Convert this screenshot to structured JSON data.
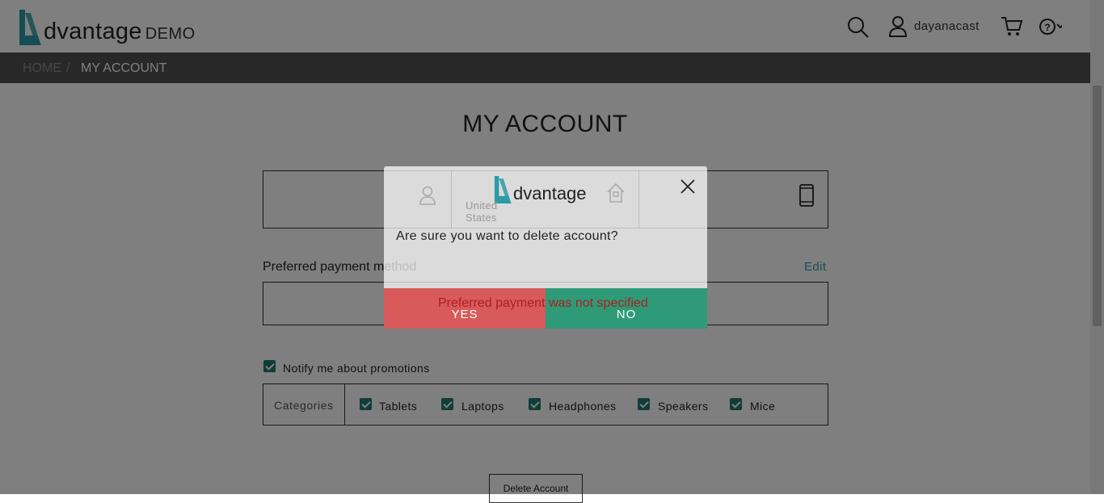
{
  "header": {
    "logo_word": "dvantage",
    "logo_suffix": "DEMO",
    "username": "dayanacast",
    "icons": [
      "search-icon",
      "user-icon",
      "cart-icon",
      "help-icon",
      "chevron-down-icon"
    ]
  },
  "breadcrumb": {
    "home": "HOME",
    "separator": "/",
    "current": "MY ACCOUNT"
  },
  "page": {
    "title": "MY ACCOUNT",
    "account_details": {
      "country": "United States"
    },
    "payment": {
      "label": "Preferred payment method",
      "edit_label": "Edit",
      "status": "Preferred payment was not specified"
    },
    "promotions": {
      "notify_label": "Notify me about promotions",
      "notify_checked": true,
      "categories_title": "Categories",
      "categories": [
        {
          "label": "Tablets",
          "checked": true
        },
        {
          "label": "Laptops",
          "checked": true
        },
        {
          "label": "Headphones",
          "checked": true
        },
        {
          "label": "Speakers",
          "checked": true
        },
        {
          "label": "Mice",
          "checked": true
        }
      ]
    },
    "delete_button": "Delete Account"
  },
  "modal": {
    "logo_word": "dvantage",
    "question": "Are sure you want to delete account?",
    "yes_label": "YES",
    "no_label": "NO"
  },
  "colors": {
    "brand_teal": "#2c9ba6",
    "yes_red": "#d85a5a",
    "no_green": "#2e9a78",
    "error_text": "#b01e1e"
  }
}
